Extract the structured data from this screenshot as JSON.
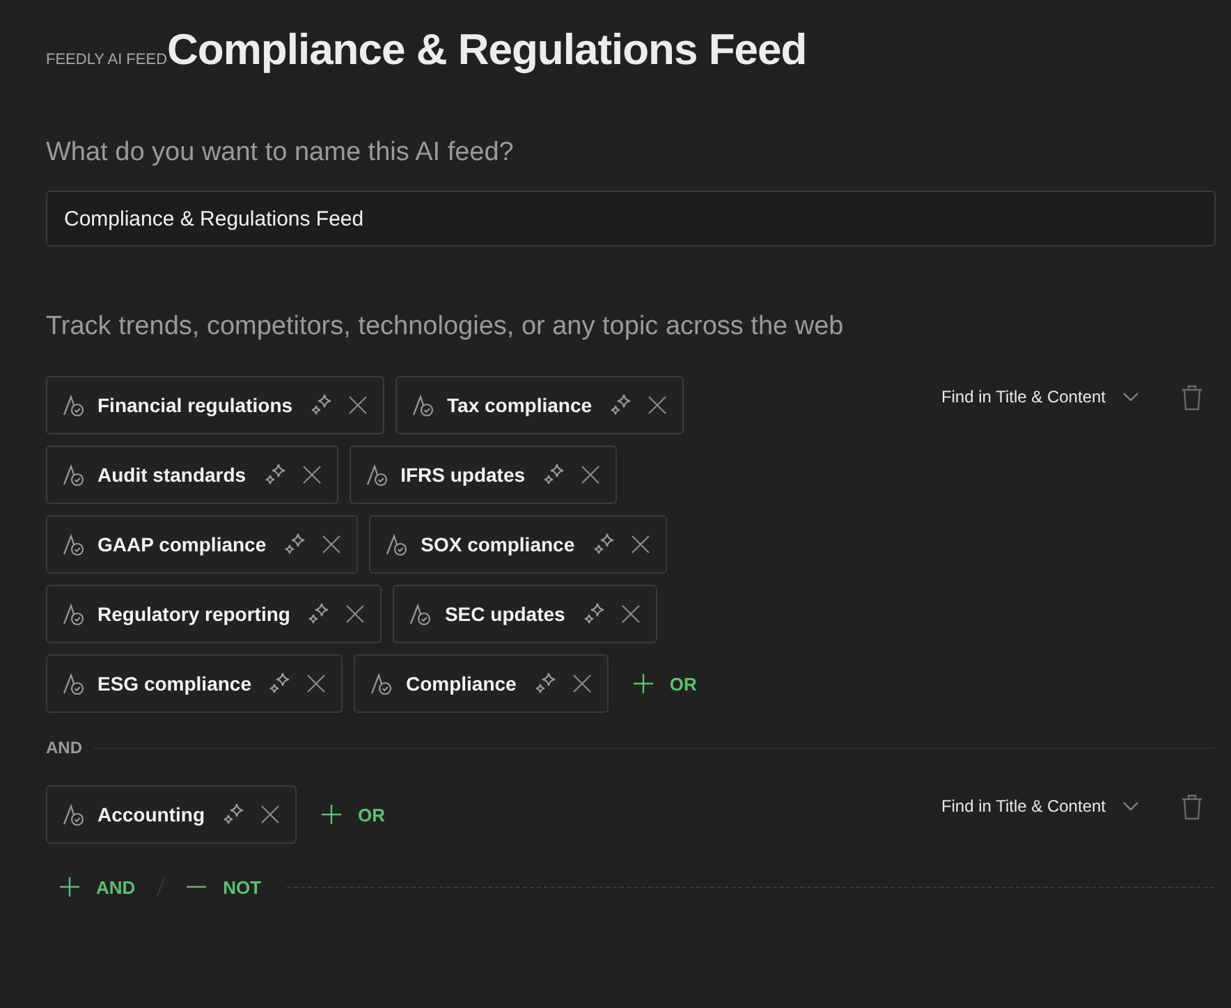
{
  "eyebrow": "FEEDLY AI FEED",
  "title": "Compliance & Regulations Feed",
  "name_question": "What do you want to name this AI feed?",
  "name_field": {
    "value": "Compliance & Regulations Feed"
  },
  "track_prompt": "Track trends, competitors, technologies, or any topic across the web",
  "groups": [
    {
      "keywords": [
        "Financial regulations",
        "Tax compliance",
        "Audit standards",
        "IFRS updates",
        "GAAP compliance",
        "SOX compliance",
        "Regulatory reporting",
        "SEC updates",
        "ESG compliance",
        "Compliance"
      ],
      "or_label": "OR",
      "scope": "Find in Title & Content"
    },
    {
      "keywords": [
        "Accounting"
      ],
      "or_label": "OR",
      "scope": "Find in Title & Content"
    }
  ],
  "group_separator": "AND",
  "footer": {
    "add_and": "AND",
    "add_not": "NOT"
  }
}
